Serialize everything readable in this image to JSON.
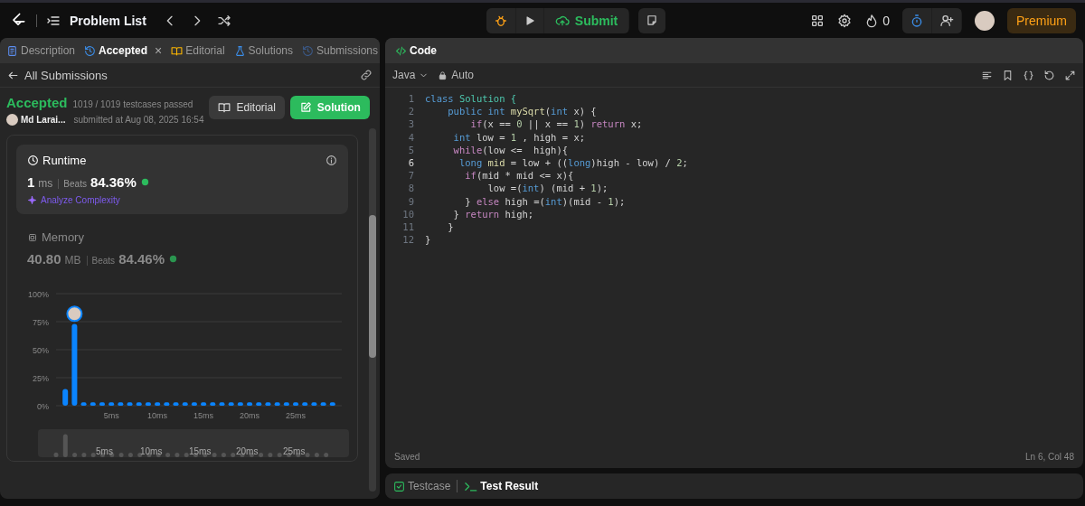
{
  "nav": {
    "title": "Problem List",
    "submit": "Submit",
    "streak": "0",
    "premium": "Premium"
  },
  "left_tabs": [
    {
      "label": "Description",
      "kind": "description",
      "selected": false
    },
    {
      "label": "Accepted",
      "kind": "history",
      "selected": true,
      "close": "×"
    },
    {
      "label": "Editorial",
      "kind": "book",
      "selected": false
    },
    {
      "label": "Solutions",
      "kind": "flask",
      "selected": false
    },
    {
      "label": "Submissions",
      "kind": "history",
      "selected": false
    }
  ],
  "back_link": "All Submissions",
  "result": {
    "status": "Accepted",
    "testcases": "1019 / 1019 testcases passed",
    "user": "Md Larai...",
    "submitted": "submitted at Aug 08, 2025 16:54",
    "editorial_button": "Editorial",
    "solution_button": "Solution"
  },
  "runtime": {
    "title": "Runtime",
    "value": "1",
    "unit": "ms",
    "beats_label": "Beats",
    "beats": "84.36%",
    "analyze": "Analyze Complexity",
    "selected": true
  },
  "memory": {
    "title": "Memory",
    "value": "40.80",
    "unit": "MB",
    "beats_label": "Beats",
    "beats": "84.46%",
    "selected": false
  },
  "chart_data": {
    "type": "bar",
    "grid": true,
    "x": [
      0,
      1,
      2,
      3,
      4,
      5,
      6,
      7,
      8,
      9,
      10,
      11,
      12,
      13,
      14,
      15,
      16,
      17,
      18,
      19,
      20,
      21,
      22,
      23,
      24,
      25,
      26,
      27,
      28,
      29
    ],
    "xlim": [
      -1,
      30
    ],
    "series": [
      {
        "color": "#0a84ff",
        "values": [
          15,
          73,
          3,
          3,
          3,
          3,
          3,
          3,
          3,
          3,
          3,
          3,
          3,
          3,
          3,
          3,
          3,
          3,
          3,
          3,
          3,
          3,
          3,
          3,
          3,
          3,
          3,
          3,
          3,
          3
        ]
      }
    ],
    "ylim": [
      0,
      100
    ],
    "yticks": [
      {
        "value": 0,
        "label": "0%"
      },
      {
        "value": 25,
        "label": "25%"
      },
      {
        "value": 50,
        "label": "50%"
      },
      {
        "value": 75,
        "label": "75%"
      },
      {
        "value": 100,
        "label": "100%"
      }
    ],
    "xticks": [
      {
        "value": 5,
        "label": "5ms"
      },
      {
        "value": 10,
        "label": "10ms"
      },
      {
        "value": 15,
        "label": "15ms"
      },
      {
        "value": 20,
        "label": "20ms"
      },
      {
        "value": 25,
        "label": "25ms"
      }
    ]
  },
  "brush_labels": [
    "5ms",
    "10ms",
    "15ms",
    "20ms",
    "25ms"
  ],
  "code_panel": {
    "title": "Code",
    "language": "Java",
    "mode": "Auto",
    "status": "Saved",
    "cursor": "Ln 6, Col 48"
  },
  "code_lines": [
    {
      "number": "1",
      "current": false,
      "tokens": [
        {
          "text": "class ",
          "kind": "kw"
        },
        {
          "text": "Solution {",
          "kind": "type"
        }
      ]
    },
    {
      "number": "2",
      "current": false,
      "tokens": [
        {
          "text": "    public int ",
          "kind": "kw"
        },
        {
          "text": "mySqrt",
          "kind": "fn"
        },
        {
          "text": "(",
          "kind": "plain"
        },
        {
          "text": "int",
          "kind": "kw"
        },
        {
          "text": " x) {",
          "kind": "plain"
        }
      ]
    },
    {
      "number": "3",
      "current": false,
      "tokens": [
        {
          "text": "        if",
          "kind": "ctl"
        },
        {
          "text": "(x == ",
          "kind": "plain"
        },
        {
          "text": "0",
          "kind": "num"
        },
        {
          "text": " || x == ",
          "kind": "plain"
        },
        {
          "text": "1",
          "kind": "num"
        },
        {
          "text": ") ",
          "kind": "plain"
        },
        {
          "text": "return",
          "kind": "ctl"
        },
        {
          "text": " x;",
          "kind": "plain"
        }
      ]
    },
    {
      "number": "4",
      "current": false,
      "tokens": [
        {
          "text": "     int",
          "kind": "kw"
        },
        {
          "text": " low = ",
          "kind": "plain"
        },
        {
          "text": "1",
          "kind": "num"
        },
        {
          "text": " , high = x;",
          "kind": "plain"
        }
      ]
    },
    {
      "number": "5",
      "current": false,
      "tokens": [
        {
          "text": "     while",
          "kind": "ctl"
        },
        {
          "text": "(low <=  high){",
          "kind": "plain"
        }
      ]
    },
    {
      "number": "6",
      "current": true,
      "tokens": [
        {
          "text": "      long",
          "kind": "kw"
        },
        {
          "text": " mid",
          "kind": "fn"
        },
        {
          "text": " = low + ((",
          "kind": "plain"
        },
        {
          "text": "long",
          "kind": "kw"
        },
        {
          "text": ")high - low) / ",
          "kind": "plain"
        },
        {
          "text": "2",
          "kind": "num"
        },
        {
          "text": ";",
          "kind": "plain"
        }
      ]
    },
    {
      "number": "7",
      "current": false,
      "tokens": [
        {
          "text": "       if",
          "kind": "ctl"
        },
        {
          "text": "(mid * mid <= x){",
          "kind": "plain"
        }
      ]
    },
    {
      "number": "8",
      "current": false,
      "tokens": [
        {
          "text": "           low =(",
          "kind": "plain"
        },
        {
          "text": "int",
          "kind": "kw"
        },
        {
          "text": ") (mid + ",
          "kind": "plain"
        },
        {
          "text": "1",
          "kind": "num"
        },
        {
          "text": ");",
          "kind": "plain"
        }
      ]
    },
    {
      "number": "9",
      "current": false,
      "tokens": [
        {
          "text": "       } ",
          "kind": "plain"
        },
        {
          "text": "else",
          "kind": "ctl"
        },
        {
          "text": " high =(",
          "kind": "plain"
        },
        {
          "text": "int",
          "kind": "kw"
        },
        {
          "text": ")(mid - ",
          "kind": "plain"
        },
        {
          "text": "1",
          "kind": "num"
        },
        {
          "text": ");",
          "kind": "plain"
        }
      ]
    },
    {
      "number": "10",
      "current": false,
      "tokens": [
        {
          "text": "     } ",
          "kind": "plain"
        },
        {
          "text": "return",
          "kind": "ctl"
        },
        {
          "text": " high;",
          "kind": "plain"
        }
      ]
    },
    {
      "number": "11",
      "current": false,
      "tokens": [
        {
          "text": "    }",
          "kind": "plain"
        }
      ]
    },
    {
      "number": "12",
      "current": false,
      "tokens": [
        {
          "text": "}",
          "kind": "plain"
        }
      ]
    }
  ],
  "bottom_tabs": [
    {
      "label": "Testcase",
      "kind": "check",
      "selected": false
    },
    {
      "label": "Test Result",
      "kind": "terminal",
      "selected": true
    }
  ]
}
